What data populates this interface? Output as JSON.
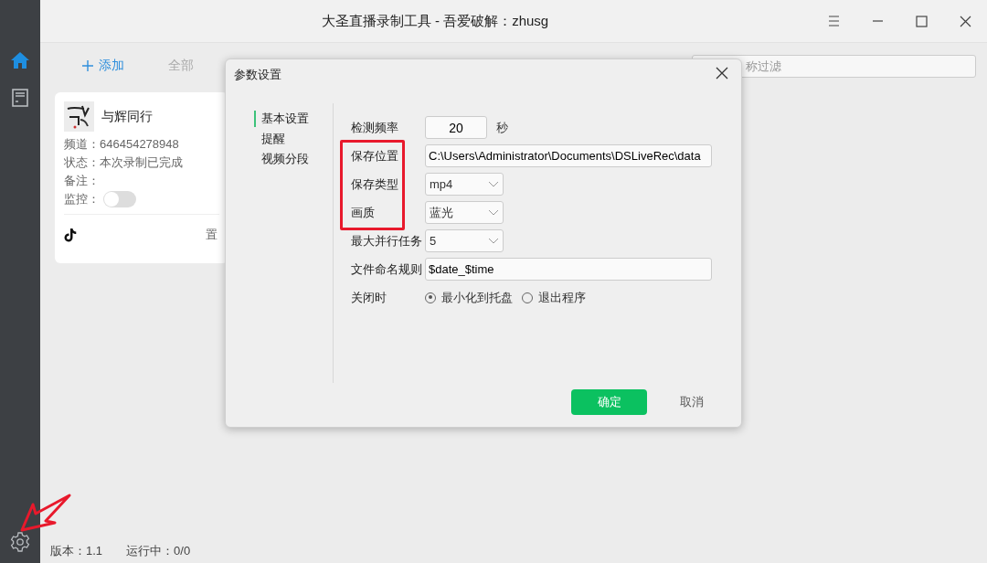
{
  "window": {
    "title": "大圣直播录制工具 - 吾爱破解：zhusg"
  },
  "sidebar": {
    "items": [
      {
        "kind": "home",
        "selected": true
      },
      {
        "kind": "document",
        "selected": false
      }
    ]
  },
  "toolbar": {
    "add_button": "添加",
    "stop_all_button": "全部",
    "filter": {
      "placeholder": "称过滤"
    }
  },
  "cards": [
    {
      "name": "与辉同行",
      "lines": [
        "频道：646454278948",
        "状态：本次录制已完成",
        "备注："
      ],
      "monitor": {
        "label": "监控：",
        "on": false
      },
      "action": "置"
    }
  ],
  "dialog": {
    "title": "参数设置",
    "nav": [
      {
        "label": "基本设置",
        "selected": true
      },
      {
        "label": "提醒",
        "selected": false
      },
      {
        "label": "视频分段",
        "selected": false
      }
    ],
    "rows": [
      {
        "kind": "number",
        "label": "检测频率",
        "value": "20",
        "unit": "秒"
      },
      {
        "kind": "text",
        "label": "保存位置",
        "value": "C:\\Users\\Administrator\\Documents\\DSLiveRec\\data"
      },
      {
        "kind": "select",
        "label": "保存类型",
        "value": "mp4"
      },
      {
        "kind": "select",
        "label": "画质",
        "value": "蓝光"
      },
      {
        "kind": "select",
        "label": "最大并行任务",
        "value": "5"
      },
      {
        "kind": "text",
        "label": "文件命名规则",
        "value": "$date_$time"
      },
      {
        "kind": "radio",
        "label": "关闭时",
        "options": [
          {
            "label": "最小化到托盘",
            "selected": true
          },
          {
            "label": "退出程序",
            "selected": false
          }
        ]
      }
    ],
    "buttons": [
      {
        "label": "确定",
        "kind": "primary"
      },
      {
        "label": "取消",
        "kind": "plain"
      }
    ]
  },
  "status_bar": {
    "version": "版本：1.1",
    "running": "运行中：0/0"
  }
}
